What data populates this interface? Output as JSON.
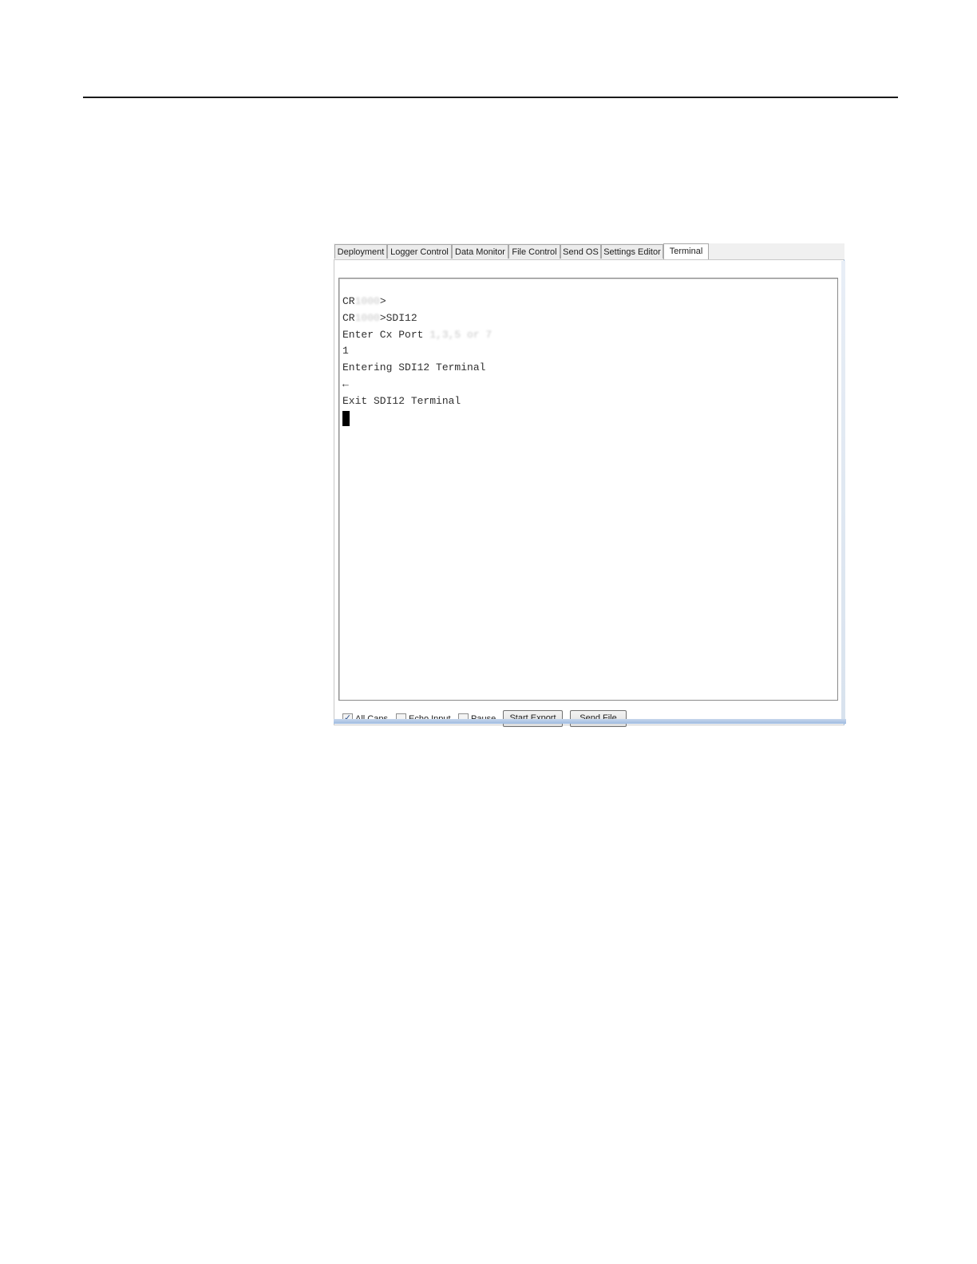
{
  "tabs": [
    {
      "label": "Deployment",
      "active": false
    },
    {
      "label": "Logger Control",
      "active": false
    },
    {
      "label": "Data Monitor",
      "active": false
    },
    {
      "label": "File Control",
      "active": false
    },
    {
      "label": "Send OS",
      "active": false
    },
    {
      "label": "Settings Editor",
      "active": false
    },
    {
      "label": "Terminal",
      "active": true
    }
  ],
  "terminal": {
    "lines": [
      {
        "prefix": "CR",
        "hidden": "1000",
        "suffix": ">"
      },
      {
        "prefix": "CR",
        "hidden": "1000",
        "suffix": ">SDI12"
      },
      {
        "prefix": "Enter Cx Port ",
        "hidden": "1,3,5 or 7",
        "suffix": ""
      },
      {
        "prefix": "1",
        "hidden": "",
        "suffix": ""
      },
      {
        "prefix": "Entering SDI12 Terminal",
        "hidden": "",
        "suffix": ""
      },
      {
        "prefix": "←",
        "hidden": "",
        "suffix": ""
      },
      {
        "prefix": "Exit SDI12 Terminal",
        "hidden": "",
        "suffix": ""
      }
    ]
  },
  "controls": {
    "all_caps_label": "All Caps",
    "all_caps_checked": true,
    "echo_input_label": "Echo Input",
    "echo_input_checked": false,
    "pause_label": "Pause",
    "pause_checked": false,
    "start_export_label": "Start Export",
    "send_file_label": "Send File"
  }
}
